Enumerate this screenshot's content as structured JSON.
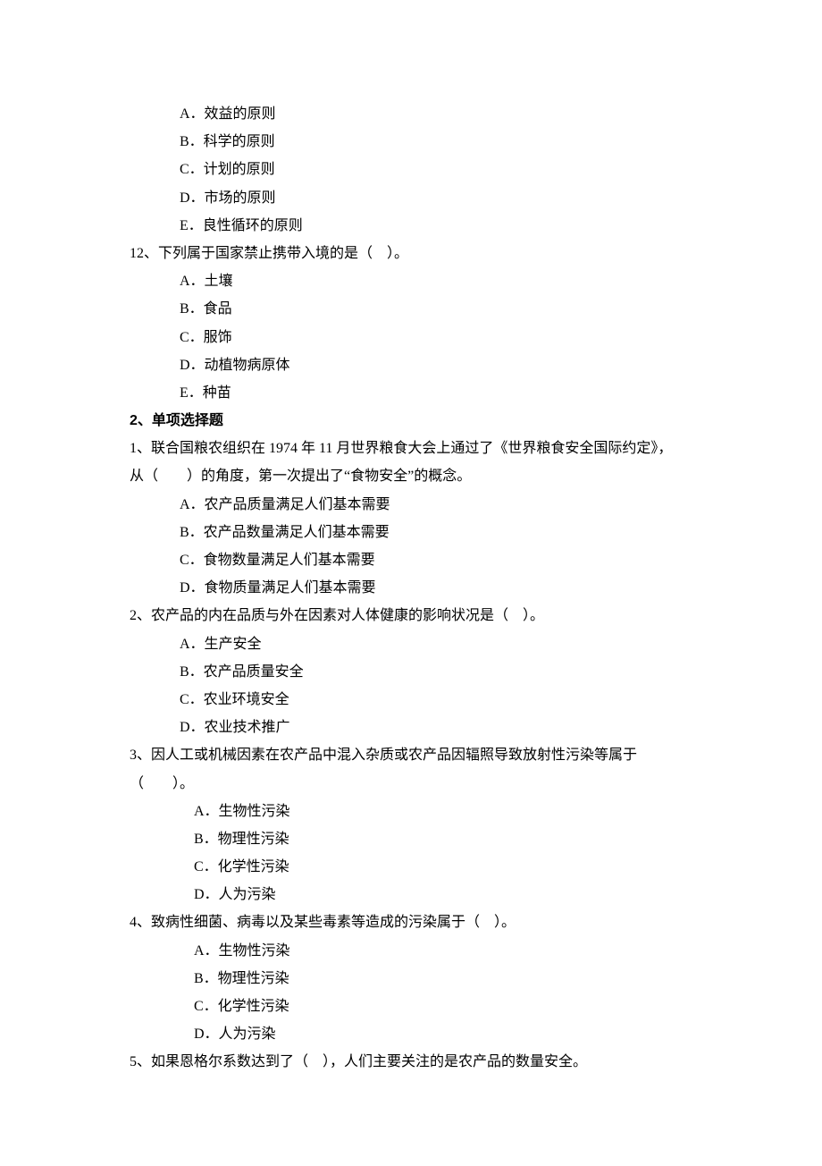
{
  "q11": {
    "options": {
      "A": "A．效益的原则",
      "B": "B．科学的原则",
      "C": "C．计划的原则",
      "D": "D．市场的原则",
      "E": "E．良性循环的原则"
    }
  },
  "q12": {
    "stem": "12、下列属于国家禁止携带入境的是（　）。",
    "options": {
      "A": "A．土壤",
      "B": "B．食品",
      "C": "C．服饰",
      "D": "D．动植物病原体",
      "E": "E．种苗"
    }
  },
  "section2": {
    "title": "2、单项选择题"
  },
  "s2q1": {
    "stem_line1": "1、联合国粮农组织在 1974 年 11 月世界粮食大会上通过了《世界粮食安全国际约定》，",
    "stem_line2": "从（　　）的角度，第一次提出了“食物安全”的概念。",
    "options": {
      "A": "A．农产品质量满足人们基本需要",
      "B": "B．农产品数量满足人们基本需要",
      "C": "C．食物数量满足人们基本需要",
      "D": "D．食物质量满足人们基本需要"
    }
  },
  "s2q2": {
    "stem": "2、农产品的内在品质与外在因素对人体健康的影响状况是（　）。",
    "options": {
      "A": "A．生产安全",
      "B": "B．农产品质量安全",
      "C": "C．农业环境安全",
      "D": "D．农业技术推广"
    }
  },
  "s2q3": {
    "stem_line1": "3、因人工或机械因素在农产品中混入杂质或农产品因辐照导致放射性污染等属于",
    "stem_line2": "（　　）。",
    "options": {
      "A": "A．生物性污染",
      "B": "B．物理性污染",
      "C": "C．化学性污染",
      "D": "D．人为污染"
    }
  },
  "s2q4": {
    "stem": "4、致病性细菌、病毒以及某些毒素等造成的污染属于（　）。",
    "options": {
      "A": "A．生物性污染",
      "B": "B．物理性污染",
      "C": "C．化学性污染",
      "D": "D．人为污染"
    }
  },
  "s2q5": {
    "stem": "5、如果恩格尔系数达到了（　），人们主要关注的是农产品的数量安全。"
  }
}
